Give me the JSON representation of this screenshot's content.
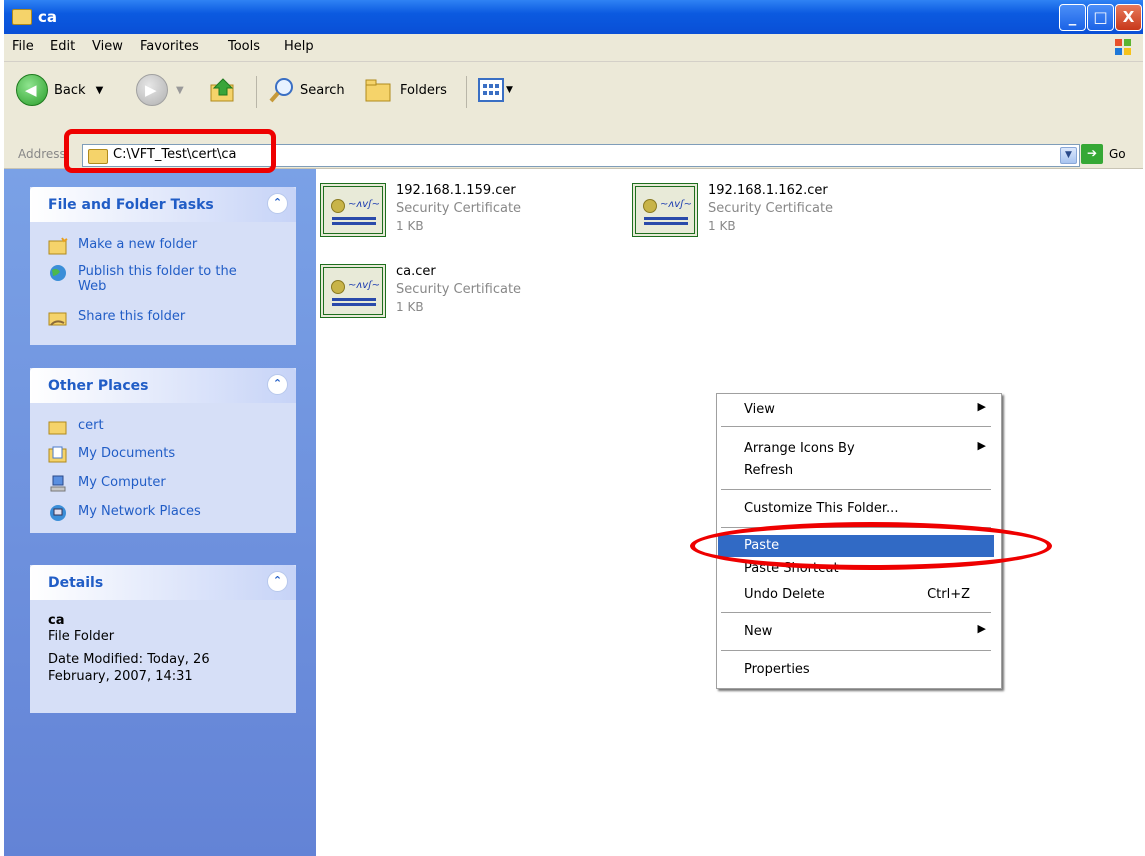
{
  "window": {
    "title": "ca",
    "buttons": [
      "_",
      "□",
      "X"
    ]
  },
  "menu": [
    "File",
    "Edit",
    "View",
    "Favorites",
    "Tools",
    "Help"
  ],
  "toolbar": {
    "back": "Back",
    "search": "Search",
    "folders": "Folders"
  },
  "address": {
    "label": "Address",
    "value": "C:\\VFT_Test\\cert\\ca",
    "go": "Go"
  },
  "tasks": {
    "file_folder": {
      "title": "File and Folder Tasks",
      "items": [
        "Make a new folder",
        "Publish this folder to the Web",
        "Share this folder"
      ]
    },
    "other_places": {
      "title": "Other Places",
      "items": [
        "cert",
        "My Documents",
        "My Computer",
        "My Network Places"
      ]
    },
    "details": {
      "title": "Details",
      "name": "ca",
      "type": "File Folder",
      "modified": "Date Modified: Today, 26 February, 2007, 14:31"
    }
  },
  "files": [
    {
      "name": "192.168.1.159.cer",
      "desc": "Security Certificate",
      "size": "1 KB"
    },
    {
      "name": "192.168.1.162.cer",
      "desc": "Security Certificate",
      "size": "1 KB"
    },
    {
      "name": "ca.cer",
      "desc": "Security Certificate",
      "size": "1 KB"
    }
  ],
  "context_menu": {
    "view": "View",
    "arrange": "Arrange Icons By",
    "refresh": "Refresh",
    "customize": "Customize This Folder...",
    "paste": "Paste",
    "paste_shortcut": "Paste Shortcut",
    "undo_delete": "Undo Delete",
    "undo_shortcut": "Ctrl+Z",
    "new": "New",
    "properties": "Properties"
  },
  "colors": {
    "highlight_red": "#ee0000",
    "selection_blue": "#316ac5",
    "task_link_blue": "#215dc6"
  }
}
